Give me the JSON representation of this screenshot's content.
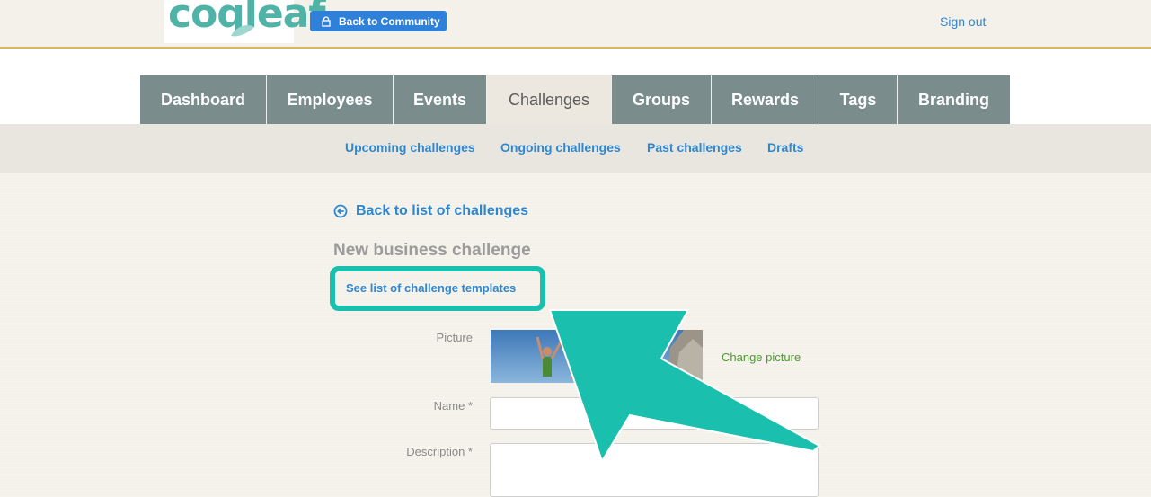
{
  "header": {
    "logo_text": "coqleaf",
    "back_button_label": "Back to Community",
    "signout_label": "Sign out"
  },
  "tabs": [
    {
      "label": "Dashboard",
      "active": false
    },
    {
      "label": "Employees",
      "active": false
    },
    {
      "label": "Events",
      "active": false
    },
    {
      "label": "Challenges",
      "active": true
    },
    {
      "label": "Groups",
      "active": false
    },
    {
      "label": "Rewards",
      "active": false
    },
    {
      "label": "Tags",
      "active": false
    },
    {
      "label": "Branding",
      "active": false
    }
  ],
  "subnav": {
    "upcoming": "Upcoming challenges",
    "ongoing": "Ongoing challenges",
    "past": "Past challenges",
    "drafts": "Drafts"
  },
  "content": {
    "back_link": "Back to list of challenges",
    "title": "New business challenge",
    "templates_link": "See list of challenge templates"
  },
  "form": {
    "picture_label": "Picture",
    "change_picture": "Change picture",
    "name_label": "Name *",
    "name_value": "",
    "description_label": "Description *",
    "description_value": ""
  },
  "colors": {
    "accent_teal": "#1bbfad",
    "link_blue": "#2f87d0",
    "tab_gray": "#7a8c8c",
    "header_gold": "#d8b95e",
    "success_green": "#4b9b2e"
  }
}
